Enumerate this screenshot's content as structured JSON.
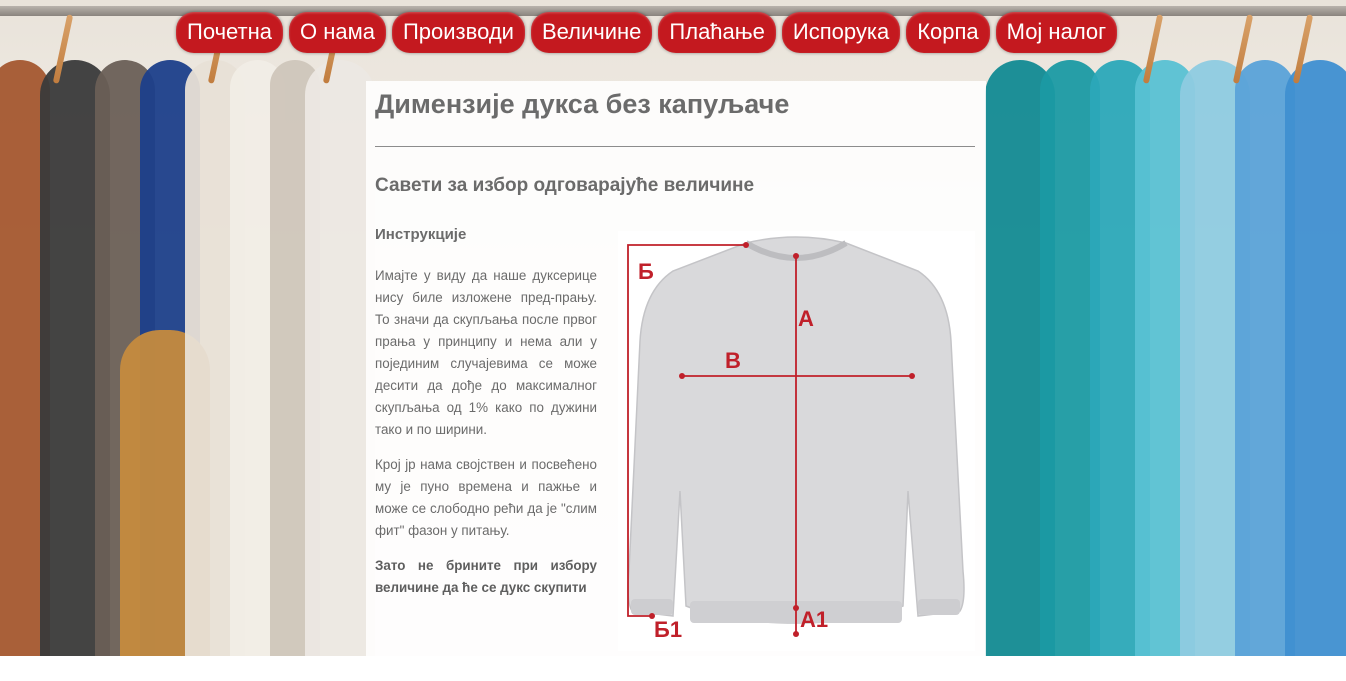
{
  "nav": {
    "items": [
      "Почетна",
      "О нама",
      "Производи",
      "Величине",
      "Плаћање",
      "Испорука",
      "Корпа",
      "Мој налог"
    ]
  },
  "page": {
    "title": "Димензије дукса без капуљаче",
    "subtitle": "Савети за избор одговарајуће величине",
    "section": "Инструкције",
    "paragraphs": [
      "Имајте у виду да наше дуксерице нису биле изложене пред-прању. То значи да скупљања после првог прања у принципу и нема али у појединим случајевима се може десити да дође до максималног скупљања од 1% како по дужини тако и по ширини.",
      "Крој јр нама својствен и посвећено му је пуно времена и пажње и може се слободно рећи да је \"слим фит\" фазон у питању.",
      "Зато не брините при избору величине да ће се дукс скупити"
    ]
  },
  "diagram": {
    "labels": {
      "a": "А",
      "a1": "А1",
      "b": "Б",
      "b1": "Б1",
      "v": "В"
    }
  },
  "colors": {
    "nav_bg": "#c4191f",
    "measure_line": "#c0202a"
  }
}
